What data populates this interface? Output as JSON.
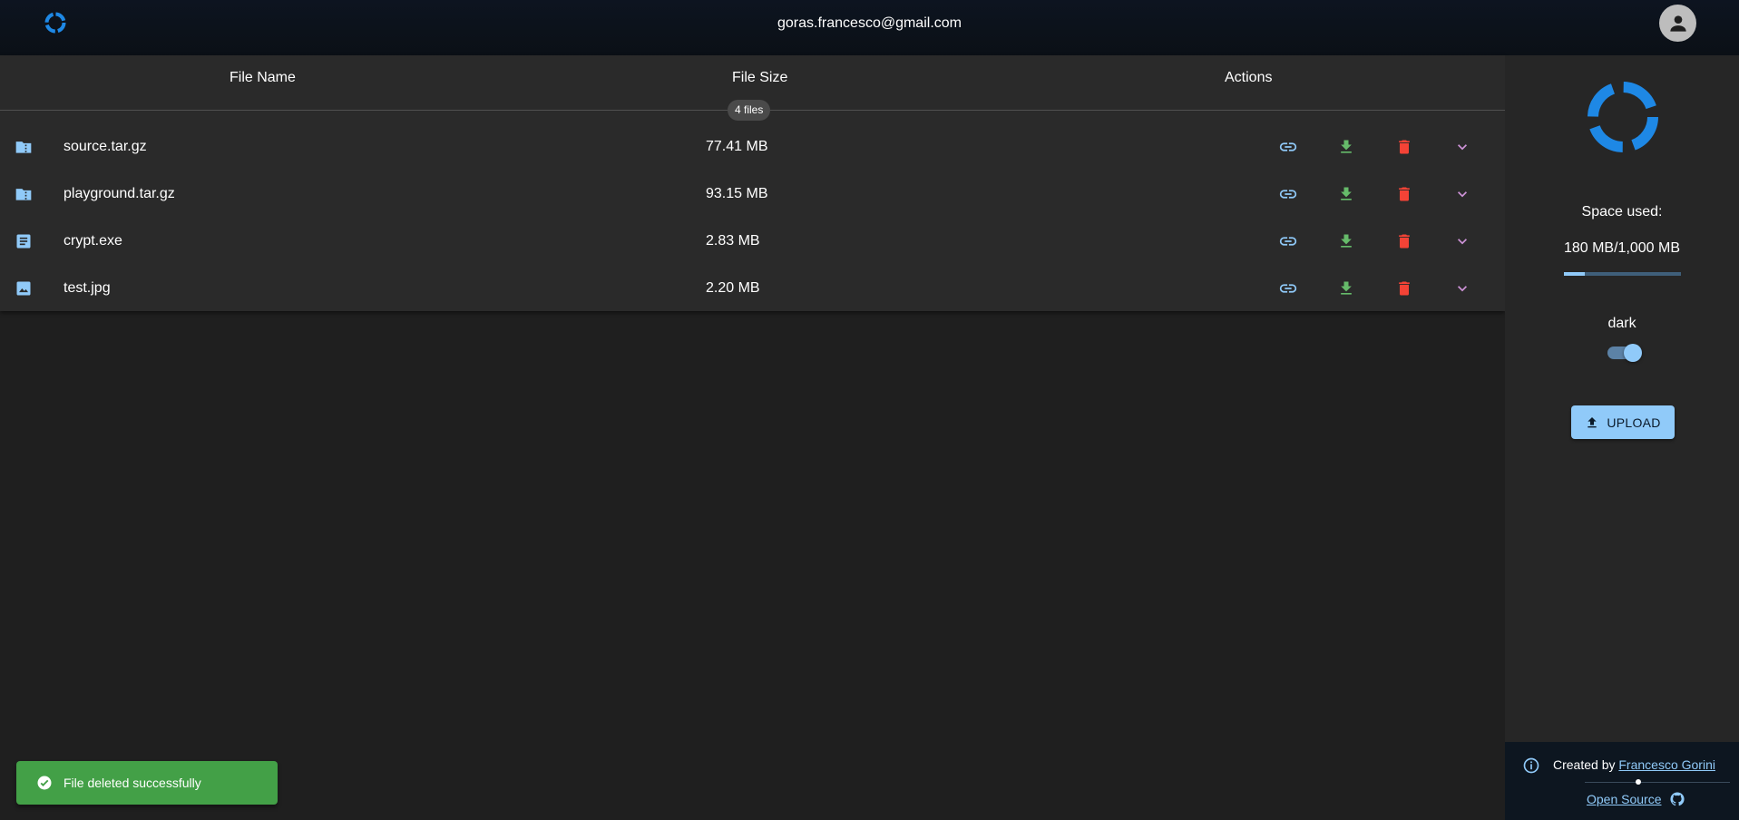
{
  "header": {
    "email": "goras.francesco@gmail.com",
    "logo_icon": "cloud-ring-logo-icon",
    "account_icon": "account-circle-icon"
  },
  "table": {
    "headers": {
      "name": "File Name",
      "size": "File Size",
      "actions": "Actions"
    },
    "count_label": "4 files",
    "rows": [
      {
        "name": "source.tar.gz",
        "size": "77.41 MB",
        "type_icon": "folder-zip-icon"
      },
      {
        "name": "playground.tar.gz",
        "size": "93.15 MB",
        "type_icon": "folder-zip-icon"
      },
      {
        "name": "crypt.exe",
        "size": "2.83 MB",
        "type_icon": "document-icon"
      },
      {
        "name": "test.jpg",
        "size": "2.20 MB",
        "type_icon": "image-icon"
      }
    ],
    "action_icons": [
      "link-icon",
      "download-icon",
      "delete-icon",
      "expand-icon"
    ]
  },
  "sidebar": {
    "space_label": "Space used:",
    "space_value": "180 MB/1,000 MB",
    "space_used_fraction": 0.18,
    "theme_label": "dark",
    "theme_dark_on": true,
    "upload_label": "UPLOAD"
  },
  "footer": {
    "created_by": "Created by",
    "author": "Francesco Gorini",
    "open_source": "Open Source"
  },
  "snackbar": {
    "message": "File deleted successfully"
  },
  "colors": {
    "accent": "#90caf9",
    "logo_blue": "#1e88e5",
    "download_green": "#66bb6a",
    "delete_red": "#f44336",
    "expand_purple": "#ce93d8",
    "success_green": "#43a047"
  }
}
